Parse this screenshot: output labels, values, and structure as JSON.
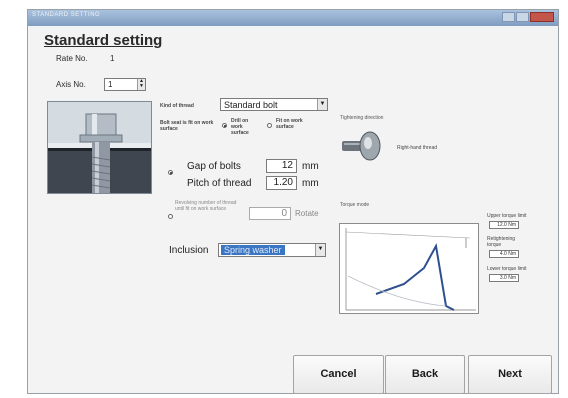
{
  "window": {
    "title": "STANDARD SETTING"
  },
  "heading": "Standard setting",
  "rate": {
    "label": "Rate No.",
    "value": "1"
  },
  "axis": {
    "label": "Axis No.",
    "value": "1"
  },
  "thread_kind": {
    "label": "Kind of thread",
    "value": "Standard bolt"
  },
  "seat_options": {
    "bolt_seat": "Bolt seat is fit on work surface",
    "drill": "Drill on work surface",
    "fit": "Fit on work surface"
  },
  "gap": {
    "label": "Gap of bolts",
    "value": "12",
    "unit": "mm"
  },
  "pitch": {
    "label": "Pitch of thread",
    "value": "1.20",
    "unit": "mm"
  },
  "revolving": {
    "label": "Revolving number of thread until fit on work surface",
    "value": "0",
    "unit": "Rotate"
  },
  "inclusion": {
    "label": "Inclusion",
    "value": "Spring washer"
  },
  "tightening": {
    "label": "Tightening direction",
    "value": "Right-hand thread"
  },
  "torque": {
    "label": "Torque mode",
    "upper_label": "Upper torque limit",
    "upper_value": "12.0 Nm",
    "retightening_label": "Retightening torque",
    "retightening_value": "4.0 Nm",
    "lower_label": "Lower torque limit",
    "lower_value": "3.0 Nm"
  },
  "buttons": {
    "cancel": "Cancel",
    "back": "Back",
    "next": "Next"
  },
  "colors": {
    "selection": "#3a76c4",
    "titlebar": "#8fabcf",
    "close": "#c4554a",
    "curve": "#2f4f8f"
  }
}
